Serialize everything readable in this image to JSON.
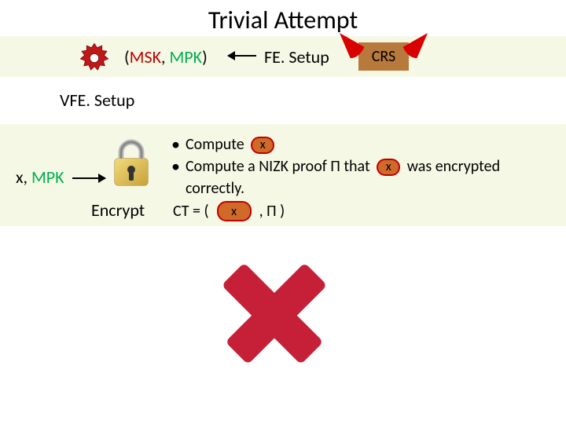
{
  "title": "Trivial Attempt",
  "row1": {
    "msk": "MSK",
    "mpk": "MPK",
    "fesetup": "FE. Setup",
    "crs": "CRS"
  },
  "vfe": "VFE. Setup",
  "row2": {
    "x": "x",
    "mpk": "MPK",
    "encrypt": "Encrypt",
    "bullet1_a": "Compute",
    "bullet1_badge": "x",
    "bullet2_a": "Compute a NIZK proof Π that",
    "bullet2_badge": "x",
    "bullet2_b": "was encrypted",
    "bullet2_c": "correctly.",
    "ct_label": "CT = (",
    "ct_badge": "x",
    "ct_mid": ",  Π )"
  }
}
